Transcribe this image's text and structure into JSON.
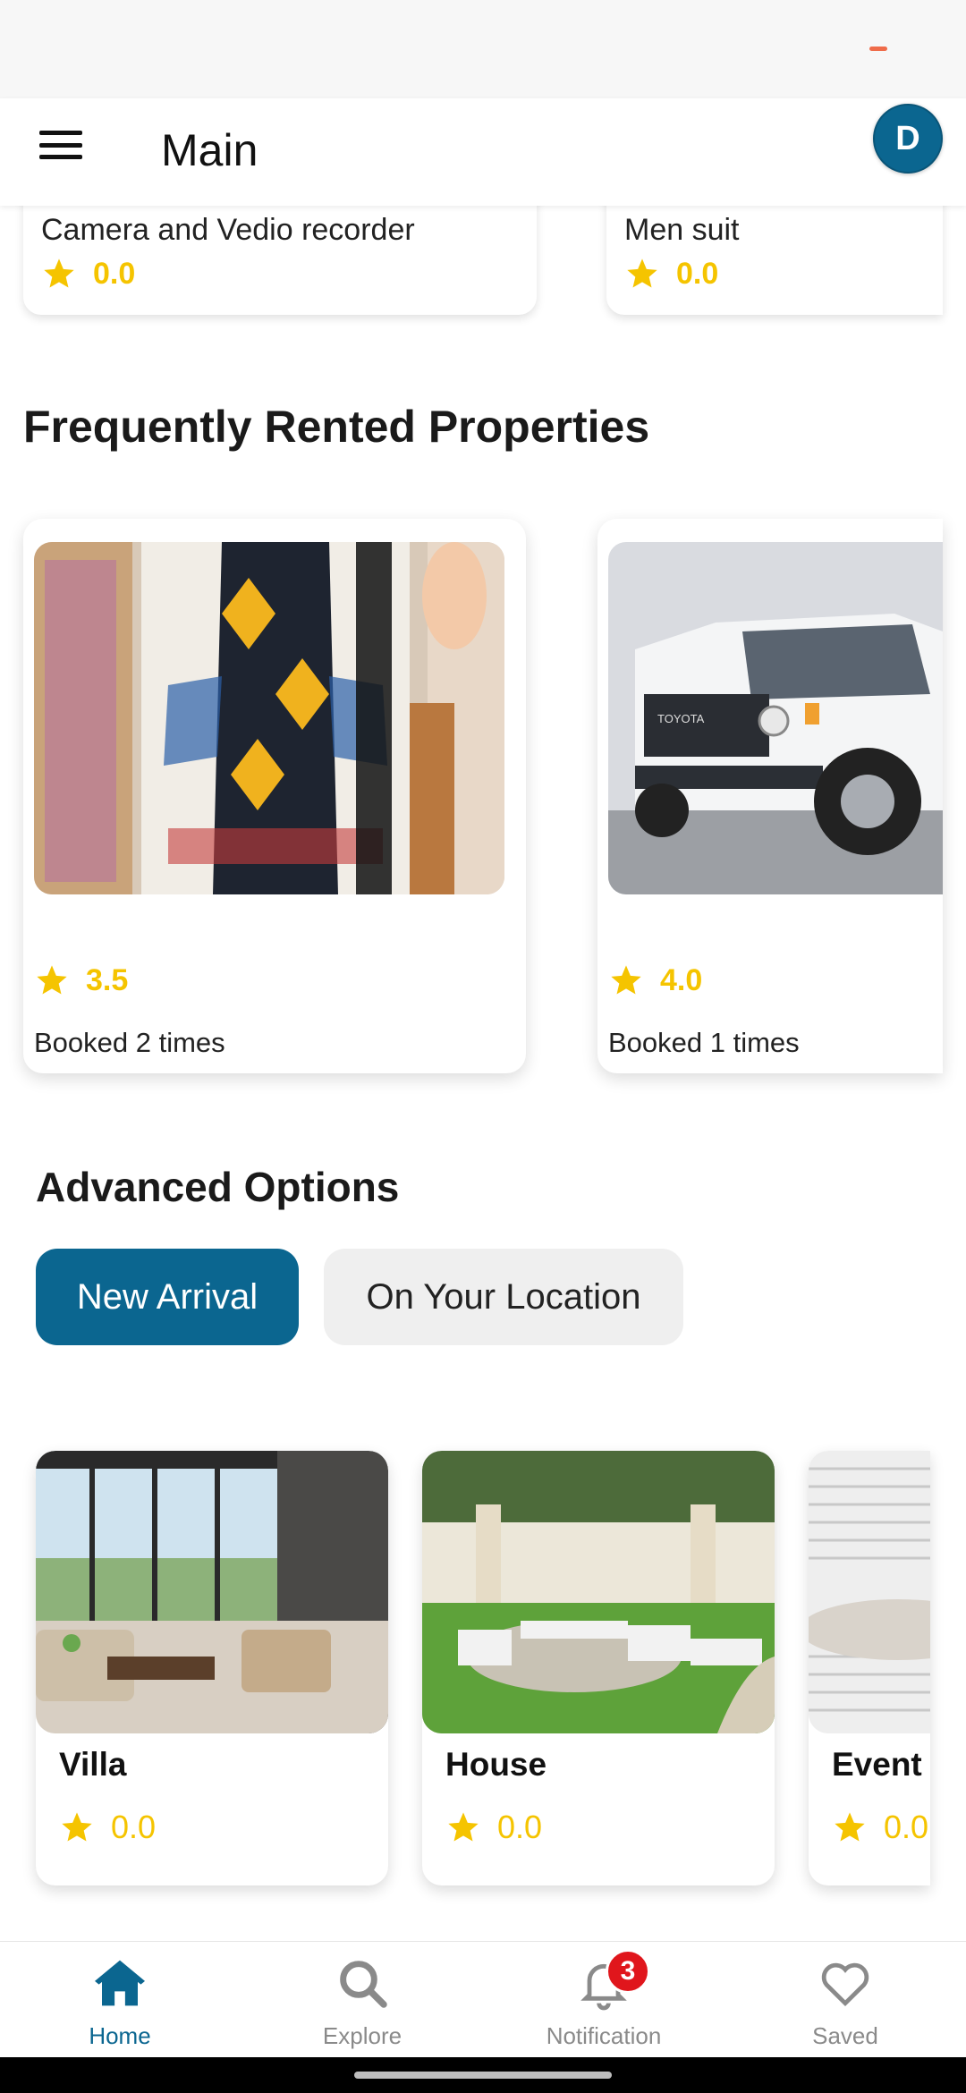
{
  "app_bar": {
    "title": "Main",
    "avatar_initial": "D",
    "menu_icon": "hamburger-menu-icon"
  },
  "top_cards": [
    {
      "name": "Camera and Vedio recorder",
      "rating": "0.0"
    },
    {
      "name": "Men suit",
      "rating": "0.0"
    }
  ],
  "frequently_rented": {
    "title": "Frequently Rented Properties",
    "items": [
      {
        "rating": "3.5",
        "booked": "Booked 2 times",
        "image": "traditional-dress-image"
      },
      {
        "rating": "4.0",
        "booked": "Booked 1 times",
        "image": "white-toyota-pickup-image"
      }
    ]
  },
  "advanced_options": {
    "title": "Advanced Options",
    "chips": [
      {
        "label": "New Arrival",
        "active": true
      },
      {
        "label": "On Your Location",
        "active": false
      }
    ]
  },
  "new_arrival": [
    {
      "name": "Villa",
      "rating": "0.0",
      "image": "villa-living-room-image"
    },
    {
      "name": "House",
      "rating": "0.0",
      "image": "garden-patio-image"
    },
    {
      "name": "Event",
      "rating": "0.0",
      "image": "stacked-plates-image"
    }
  ],
  "bottom_nav": [
    {
      "label": "Home",
      "icon": "home-icon",
      "active": true
    },
    {
      "label": "Explore",
      "icon": "search-icon",
      "active": false
    },
    {
      "label": "Notification",
      "icon": "bell-icon",
      "active": false,
      "badge": "3"
    },
    {
      "label": "Saved",
      "icon": "heart-icon",
      "active": false
    }
  ],
  "colors": {
    "primary": "#0b6690",
    "star": "#f5c400",
    "badge": "#e0161c"
  }
}
